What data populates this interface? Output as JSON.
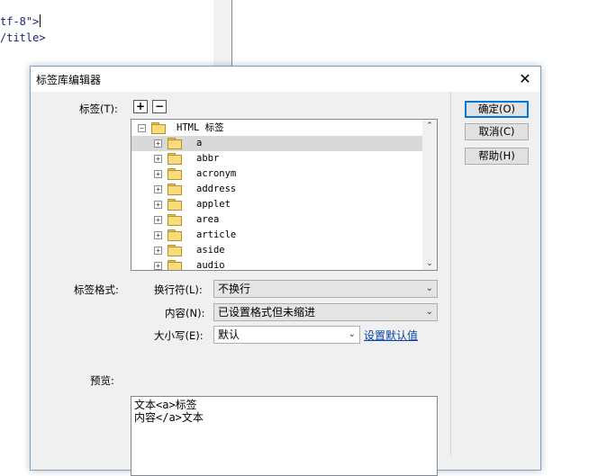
{
  "editor": {
    "line1": "tf-8\">",
    "line2": "/title>"
  },
  "dialog": {
    "title": "标签库编辑器",
    "close_glyph": "✕"
  },
  "tag_label": "标签(T):",
  "add_glyph": "+",
  "remove_glyph": "−",
  "tree": {
    "root": "HTML 标签",
    "items": [
      "a",
      "abbr",
      "acronym",
      "address",
      "applet",
      "area",
      "article",
      "aside",
      "audio"
    ],
    "selected_index": 0,
    "scroll_up": "⌃",
    "scroll_down": "⌄"
  },
  "format": {
    "section_label": "标签格式:",
    "linebreak_label": "换行符(L):",
    "linebreak_value": "不换行",
    "content_label": "内容(N):",
    "content_value": "已设置格式但未缩进",
    "case_label": "大小写(E):",
    "case_value": "默认",
    "set_default_link": "设置默认值"
  },
  "preview": {
    "label": "预览:",
    "line1": "文本<a>标签",
    "line2": "内容</a>文本"
  },
  "buttons": {
    "ok": "确定(O)",
    "cancel": "取消(C)",
    "help": "帮助(H)"
  },
  "icons": {
    "folder": "folder-icon",
    "expander": "plus-box-icon",
    "collapse": "minus-box-icon",
    "dropdown": "chevron-down-icon"
  }
}
